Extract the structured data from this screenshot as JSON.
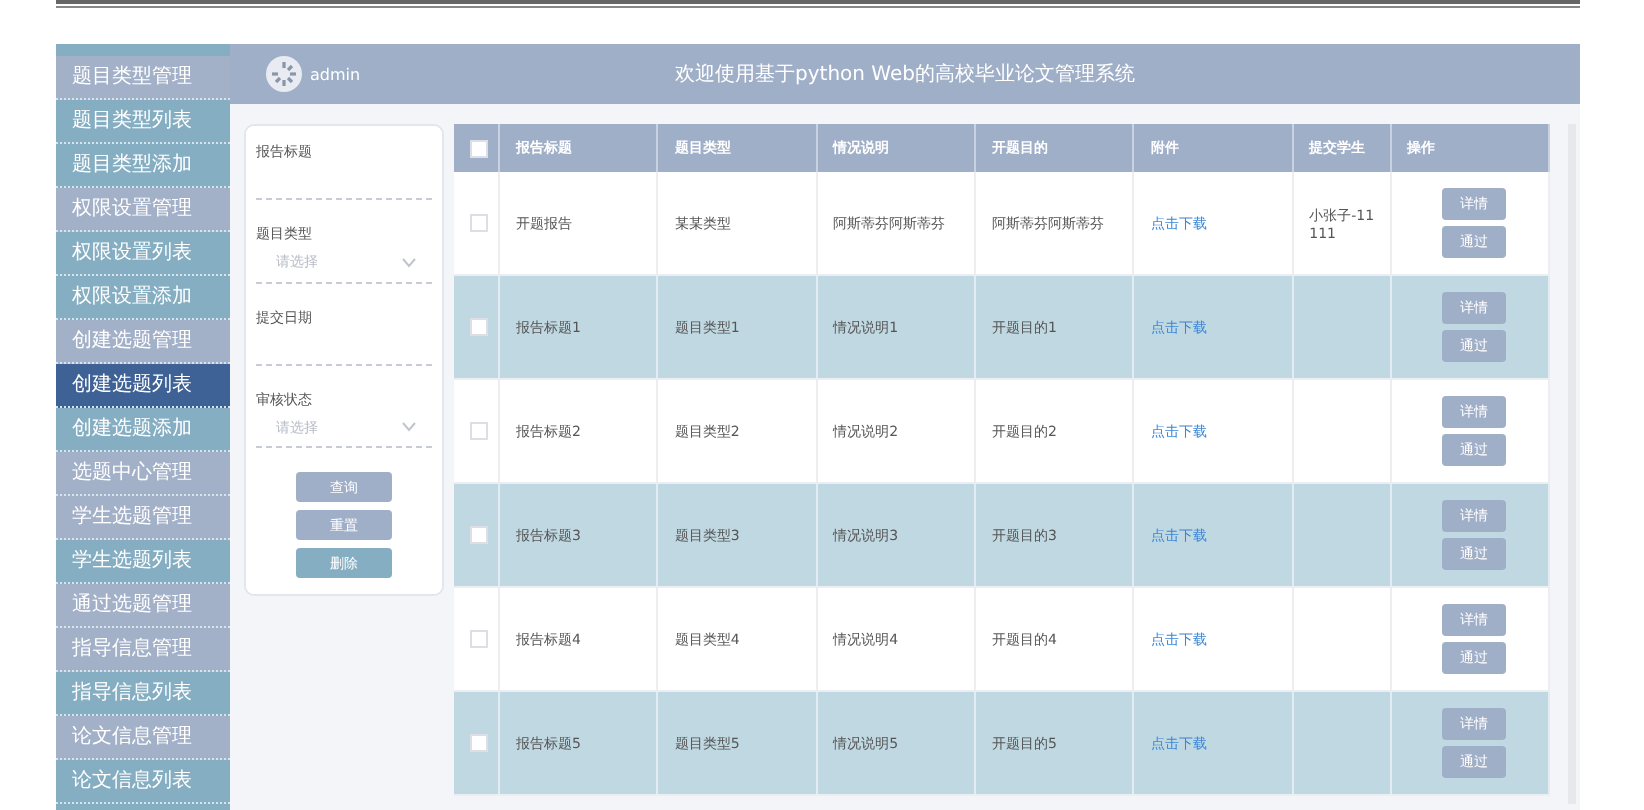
{
  "sidebar": {
    "items": [
      {
        "label": "题目类型管理",
        "kind": "group",
        "selected": false
      },
      {
        "label": "题目类型列表",
        "kind": "link",
        "selected": false
      },
      {
        "label": "题目类型添加",
        "kind": "link",
        "selected": false
      },
      {
        "label": "权限设置管理",
        "kind": "group",
        "selected": false
      },
      {
        "label": "权限设置列表",
        "kind": "link",
        "selected": false
      },
      {
        "label": "权限设置添加",
        "kind": "link",
        "selected": false
      },
      {
        "label": "创建选题管理",
        "kind": "group",
        "selected": false
      },
      {
        "label": "创建选题列表",
        "kind": "link",
        "selected": true
      },
      {
        "label": "创建选题添加",
        "kind": "link",
        "selected": false
      },
      {
        "label": "选题中心管理",
        "kind": "group",
        "selected": false
      },
      {
        "label": "学生选题管理",
        "kind": "group",
        "selected": false
      },
      {
        "label": "学生选题列表",
        "kind": "link",
        "selected": false
      },
      {
        "label": "通过选题管理",
        "kind": "group",
        "selected": false
      },
      {
        "label": "指导信息管理",
        "kind": "group",
        "selected": false
      },
      {
        "label": "指导信息列表",
        "kind": "link",
        "selected": false
      },
      {
        "label": "论文信息管理",
        "kind": "group",
        "selected": false
      },
      {
        "label": "论文信息列表",
        "kind": "link",
        "selected": false
      }
    ]
  },
  "header": {
    "user": "admin",
    "title": "欢迎使用基于python Web的高校毕业论文管理系统"
  },
  "search": {
    "fields": [
      {
        "label": "报告标题",
        "kind": "text"
      },
      {
        "label": "题目类型",
        "kind": "select",
        "placeholder": "请选择"
      },
      {
        "label": "提交日期",
        "kind": "text"
      },
      {
        "label": "审核状态",
        "kind": "select",
        "placeholder": "请选择"
      }
    ],
    "buttons": [
      {
        "label": "查询",
        "disabled": false
      },
      {
        "label": "重置",
        "disabled": false
      },
      {
        "label": "删除",
        "disabled": true
      }
    ]
  },
  "table": {
    "all_checked": false,
    "columns": [
      "报告标题",
      "题目类型",
      "情况说明",
      "开题目的",
      "附件",
      "提交学生",
      "操作"
    ],
    "rows": [
      {
        "checked": false,
        "cells": [
          "开题报告",
          "某某类型",
          "阿斯蒂芬阿斯蒂芬",
          "阿斯蒂芬阿斯蒂芬"
        ],
        "attachment": "点击下载",
        "student": "小张子-11111",
        "actions": [
          "详情",
          "通过"
        ]
      },
      {
        "checked": false,
        "cells": [
          "报告标题1",
          "题目类型1",
          "情况说明1",
          "开题目的1"
        ],
        "attachment": "点击下载",
        "actions": [
          "详情",
          "通过"
        ]
      },
      {
        "checked": false,
        "cells": [
          "报告标题2",
          "题目类型2",
          "情况说明2",
          "开题目的2"
        ],
        "attachment": "点击下载",
        "actions": [
          "详情",
          "通过"
        ]
      },
      {
        "checked": false,
        "cells": [
          "报告标题3",
          "题目类型3",
          "情况说明3",
          "开题目的3"
        ],
        "attachment": "点击下载",
        "actions": [
          "详情",
          "通过"
        ]
      },
      {
        "checked": false,
        "cells": [
          "报告标题4",
          "题目类型4",
          "情况说明4",
          "开题目的4"
        ],
        "attachment": "点击下载",
        "actions": [
          "详情",
          "通过"
        ]
      },
      {
        "checked": false,
        "cells": [
          "报告标题5",
          "题目类型5",
          "情况说明5",
          "开题目的5"
        ],
        "attachment": "点击下载",
        "actions": [
          "详情",
          "通过"
        ]
      }
    ]
  }
}
